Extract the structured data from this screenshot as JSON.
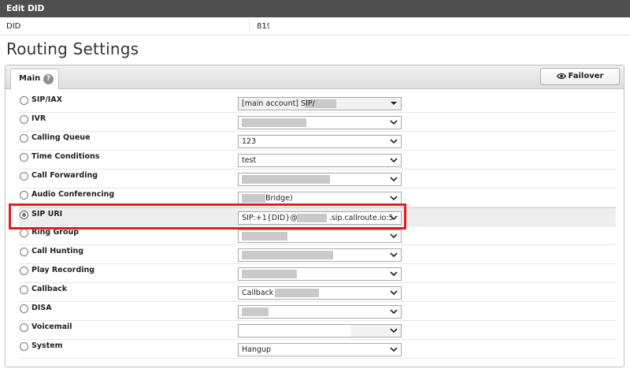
{
  "window": {
    "title": "Edit DID"
  },
  "did": {
    "label": "DID",
    "value": "819"
  },
  "page_title": "Routing Settings",
  "tabs": {
    "main_label": "Main",
    "help_glyph": "?"
  },
  "failover": {
    "label": "Failover",
    "icon": "eye-icon"
  },
  "routes": [
    {
      "label": "SIP/IAX",
      "value": "[main account] SIP/",
      "selected": false
    },
    {
      "label": "IVR",
      "value": "",
      "selected": false
    },
    {
      "label": "Calling Queue",
      "value": "123",
      "selected": false
    },
    {
      "label": "Time Conditions",
      "value": "test",
      "selected": false
    },
    {
      "label": "Call Forwarding",
      "value": "",
      "selected": false
    },
    {
      "label": "Audio Conferencing",
      "value": "Bridge)",
      "selected": false
    },
    {
      "label": "SIP URI",
      "value": "SIP:+1{DID}@",
      "value_suffix": ".sip.callroute.io:5",
      "selected": true
    },
    {
      "label": "Ring Group",
      "value": "",
      "selected": false
    },
    {
      "label": "Call Hunting",
      "value": "",
      "selected": false
    },
    {
      "label": "Play Recording",
      "value": "",
      "selected": false
    },
    {
      "label": "Callback",
      "value": "Callback",
      "selected": false
    },
    {
      "label": "DISA",
      "value": "",
      "selected": false
    },
    {
      "label": "Voicemail",
      "value": "",
      "selected": false
    },
    {
      "label": "System",
      "value": "Hangup",
      "selected": false
    }
  ],
  "colors": {
    "highlight_border": "#e0201b",
    "titlebar": "#4f4f4f"
  }
}
